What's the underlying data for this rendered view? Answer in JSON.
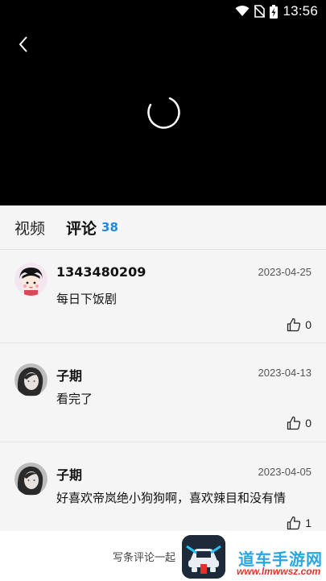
{
  "status_bar": {
    "time": "13:56"
  },
  "tabs": {
    "video_label": "视频",
    "comments_label": "评论",
    "comments_count": "38"
  },
  "comments": [
    {
      "user": "1343480209",
      "date": "2023-04-25",
      "text": "每日下饭剧",
      "likes": "0"
    },
    {
      "user": "子期",
      "date": "2023-04-13",
      "text": "看完了",
      "likes": "0"
    },
    {
      "user": "子期",
      "date": "2023-04-05",
      "text": "好喜欢帝岚绝小狗狗啊，喜欢辣目和没有情",
      "likes": "1"
    }
  ],
  "bottom_bar": {
    "input_placeholder": "写条评论一起"
  },
  "watermark": {
    "title": "道车手游网",
    "url": "www.lmwwsz.com"
  },
  "colors": {
    "accent": "#1e88e5",
    "player_bg": "#000000",
    "watermark_blue": "#29a7e1",
    "watermark_red": "#e4322b"
  }
}
